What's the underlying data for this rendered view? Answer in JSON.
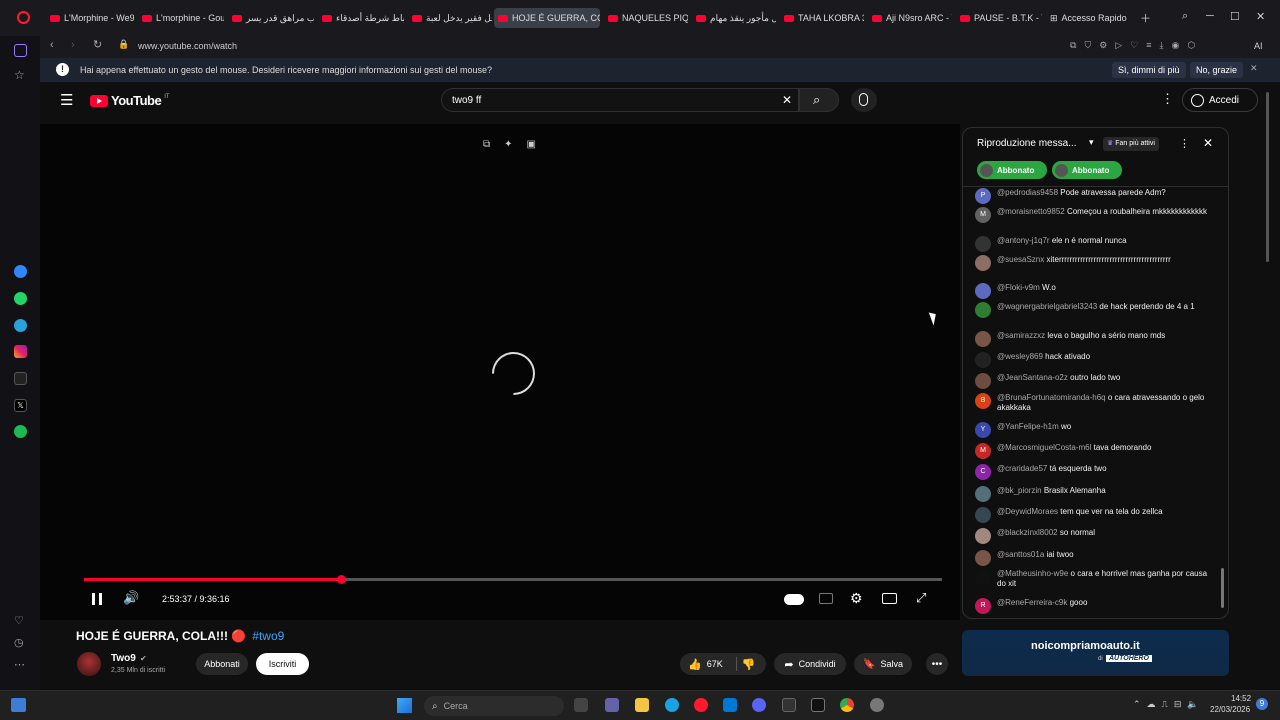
{
  "browser": {
    "tabs": [
      {
        "label": "L'Morphine - We9t"
      },
      {
        "label": "L'morphine - Gour"
      },
      {
        "label": "شاب مراهق قدر يسر"
      },
      {
        "label": "ضباط شرطة أصدقاء"
      },
      {
        "label": "رجل فقير يدخل لعبة"
      },
      {
        "label": "HOJE É GUERRA, COL"
      },
      {
        "label": "NAQUELES PIQUE /"
      },
      {
        "label": "قاتل مأجور ينقذ مهام"
      },
      {
        "label": "TAHA LKOBRA 3 -"
      },
      {
        "label": "Aji N9sro ARC - You"
      },
      {
        "label": "PAUSE - B.T.K - You"
      },
      {
        "label": "Accesso Rapido"
      }
    ],
    "url": "www.youtube.com/watch",
    "ai_label": "AI",
    "notification": {
      "text": "Hai appena effettuato un gesto del mouse. Desideri ricevere maggiori informazioni sui gesti del mouse?",
      "yes": "Sì, dimmi di più",
      "no": "No, grazie"
    }
  },
  "youtube": {
    "logo_text": "YouTube",
    "logo_country": "IT",
    "search_value": "two9 ff",
    "sign_in": "Accedi",
    "player": {
      "time": "2:53:37 / 9:36:16",
      "progress": 0.3
    },
    "video": {
      "title": "HOJE É GUERRA, COLA!!! 🔴",
      "hashtag": "#two9",
      "channel": "Two9",
      "subscribers": "2,35 Mln di iscritti",
      "join": "Abbonati",
      "subscribe": "Iscriviti",
      "likes": "67K",
      "share": "Condividi",
      "save": "Salva"
    },
    "chat": {
      "header": "Riproduzione messa...",
      "top_fans": "Fan più attivi",
      "badges": [
        "Abbonato",
        "Abbonato"
      ],
      "messages": [
        {
          "author": "@pedrodias9458",
          "text": "Pode atravessa parede Adm?",
          "initial": "P",
          "color": "#5c6bc0"
        },
        {
          "author": "@moraisnetto9852",
          "text": "Começou a roubalheira mkkkkkkkkkkkk",
          "initial": "M",
          "color": "#616161"
        },
        {
          "author": "@antony-j1q7r",
          "text": "ele n é normal nunca",
          "initial": "",
          "color": "#333333"
        },
        {
          "author": "@suesaSznx",
          "text": "xiterrrrrrrrrrrrrrrrrrrrrrrrrrrrrrrrrrrrrrrrrr",
          "initial": "",
          "color": "#8d6e63"
        },
        {
          "author": "@Floki-v9m",
          "text": "W.o",
          "initial": "",
          "color": "#5c6bc0"
        },
        {
          "author": "@wagnergabrielgabriel3243",
          "text": "de hack perdendo de 4 a 1",
          "initial": "",
          "color": "#2e7d32"
        },
        {
          "author": "@samirazzxz",
          "text": "leva o bagulho a sério mano mds",
          "initial": "",
          "color": "#795548"
        },
        {
          "author": "@wesley869",
          "text": "hack ativado",
          "initial": "",
          "color": "#222222"
        },
        {
          "author": "@JeanSantana-o2z",
          "text": "outro lado two",
          "initial": "",
          "color": "#6d4c41"
        },
        {
          "author": "@BrunaFortunatomiranda-h6q",
          "text": "o cara atravessando o gelo akakkaka",
          "initial": "B",
          "color": "#d84315"
        },
        {
          "author": "@YanFelipe-h1m",
          "text": "wo",
          "initial": "Y",
          "color": "#3949ab"
        },
        {
          "author": "@MarcosmiguelCosta-m6l",
          "text": "tava demorando",
          "initial": "M",
          "color": "#c62828"
        },
        {
          "author": "@craridade57",
          "text": "tá esquerda two",
          "initial": "C",
          "color": "#8e24aa"
        },
        {
          "author": "@bk_piorzin",
          "text": "Brasilx Alemanha",
          "initial": "",
          "color": "#546e7a"
        },
        {
          "author": "@DeywidMoraes",
          "text": "tem que ver na tela do zellca",
          "initial": "",
          "color": "#37474f"
        },
        {
          "author": "@blackzinxl8002",
          "text": "so normal",
          "initial": "",
          "color": "#a1887f"
        },
        {
          "author": "@santtos01a",
          "text": "iai twoo",
          "initial": "",
          "color": "#795548"
        },
        {
          "author": "@Matheusinho-w9e",
          "text": "o cara e horrivel mas ganha por causa do xit",
          "initial": "",
          "color": "#111111"
        },
        {
          "author": "@ReneFerreira-c9k",
          "text": "gooo",
          "initial": "R",
          "color": "#c2185b"
        }
      ]
    },
    "ad": {
      "brand": "noicompriamoauto.it",
      "sub": "di",
      "partner": "AUTOHERO"
    }
  },
  "taskbar": {
    "search_placeholder": "Cerca",
    "time": "14:52",
    "date": "22/03/2026",
    "notif_count": "9"
  },
  "colors": {
    "accent": "#ff0033",
    "chat_badge": "#2ba640"
  }
}
